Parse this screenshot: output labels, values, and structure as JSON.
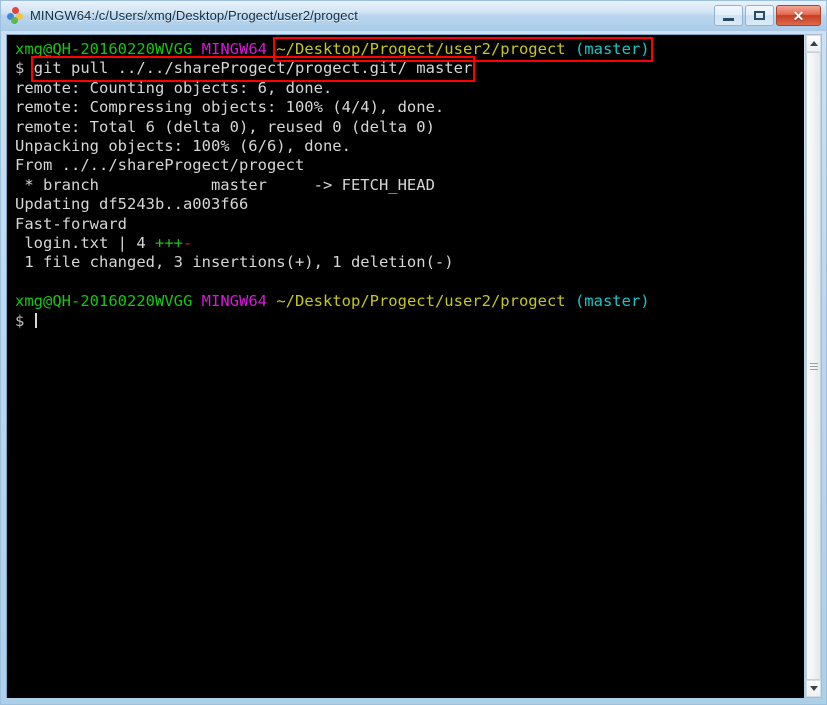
{
  "window": {
    "title": "MINGW64:/c/Users/xmg/Desktop/Progect/user2/progect",
    "icon": "mintty-icon",
    "buttons": {
      "minimize": "–",
      "maximize": "□",
      "close": "✕"
    }
  },
  "terminal": {
    "prompt1": {
      "user_host": "xmg@QH-20160220WVGG",
      "shell": "MINGW64",
      "path": "~/Desktop/Progect/user2/progect",
      "branch": "(master)"
    },
    "command_line": {
      "sigil": "$",
      "command": "git pull ../../shareProgect/progect.git/ master"
    },
    "output": [
      "remote: Counting objects: 6, done.",
      "remote: Compressing objects: 100% (4/4), done.",
      "remote: Total 6 (delta 0), reused 0 (delta 0)",
      "Unpacking objects: 100% (6/6), done.",
      "From ../../shareProgect/progect",
      " * branch            master     -> FETCH_HEAD",
      "Updating df5243b..a003f66",
      "Fast-forward"
    ],
    "diffstat": {
      "file": " login.txt | 4 ",
      "plus": "+++",
      "minus": "-"
    },
    "summary": " 1 file changed, 3 insertions(+), 1 deletion(-)",
    "prompt2": {
      "user_host": "xmg@QH-20160220WVGG",
      "shell": "MINGW64",
      "path": "~/Desktop/Progect/user2/progect",
      "branch": "(master)"
    },
    "final_sigil": "$"
  },
  "annotations": {
    "highlight_path": "~/Desktop/Progect/user2/progect (master)",
    "highlight_command": "git pull ../../shareProgect/progect.git/ master",
    "color": "#ff0000"
  },
  "colors": {
    "background": "#000000",
    "green": "#17c417",
    "magenta": "#d818d8",
    "yellow": "#c7c719",
    "cyan": "#17c7c7",
    "white": "#d6d6d6",
    "red": "#d81818",
    "title_text": "#0c2b44"
  }
}
